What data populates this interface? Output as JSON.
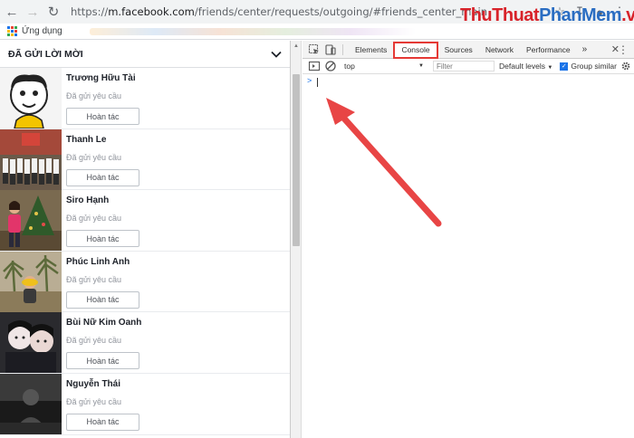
{
  "browser": {
    "url_prefix": "https://",
    "url_host": "m.facebook.com",
    "url_path": "/friends/center/requests/outgoing/#friends_center_main",
    "bookmark_apps_label": "Ứng dụng"
  },
  "watermark": {
    "part_a": "ThuThuat",
    "part_b": "PhanMem",
    "part_c": ".vn"
  },
  "facebook": {
    "section_title": "ĐÃ GỬI LỜI MỜI",
    "requests": [
      {
        "name": "Trương Hữu Tài",
        "status": "Đã gửi yêu cầu",
        "undo": "Hoàn tác"
      },
      {
        "name": "Thanh Le",
        "status": "Đã gửi yêu cầu",
        "undo": "Hoàn tác"
      },
      {
        "name": "Siro Hạnh",
        "status": "Đã gửi yêu cầu",
        "undo": "Hoàn tác"
      },
      {
        "name": "Phúc Linh Anh",
        "status": "Đã gửi yêu cầu",
        "undo": "Hoàn tác"
      },
      {
        "name": "Bùi Nữ Kim Oanh",
        "status": "Đã gửi yêu cầu",
        "undo": "Hoàn tác"
      },
      {
        "name": "Nguyễn Thái",
        "status": "Đã gửi yêu cầu",
        "undo": "Hoàn tác"
      }
    ]
  },
  "devtools": {
    "tabs": [
      "Elements",
      "Console",
      "Sources",
      "Network",
      "Performance"
    ],
    "active_tab": "Console",
    "more": "»",
    "context": "top",
    "filter_placeholder": "Filter",
    "levels": "Default levels",
    "group_similar": "Group similar",
    "prompt": ">",
    "highlight_color": "#e53935",
    "arrow_color": "#e84545"
  }
}
